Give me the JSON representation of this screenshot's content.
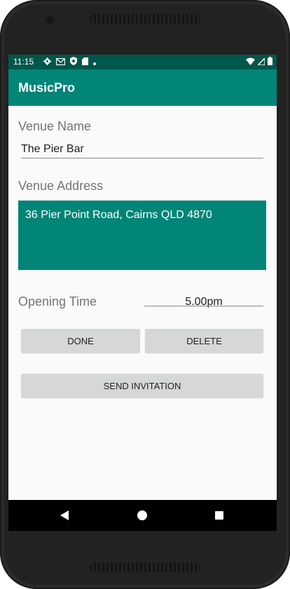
{
  "statusbar": {
    "time": "11:15",
    "icons": [
      "gear-icon",
      "gmail-icon",
      "shield-icon",
      "sdcard-icon",
      "dot-icon"
    ],
    "right_icons": [
      "wifi-icon",
      "signal-icon",
      "battery-icon"
    ]
  },
  "appbar": {
    "title": "MusicPro"
  },
  "form": {
    "venue_name_label": "Venue Name",
    "venue_name_value": "The Pier Bar",
    "venue_address_label": "Venue Address",
    "venue_address_value": "36 Pier Point Road, Cairns QLD 4870",
    "opening_time_label": "Opening Time",
    "opening_time_value": "5.00pm"
  },
  "buttons": {
    "done": "DONE",
    "delete": "DELETE",
    "send_invitation": "SEND INVITATION"
  },
  "colors": {
    "primary": "#008577",
    "primary_dark": "#00574b"
  }
}
